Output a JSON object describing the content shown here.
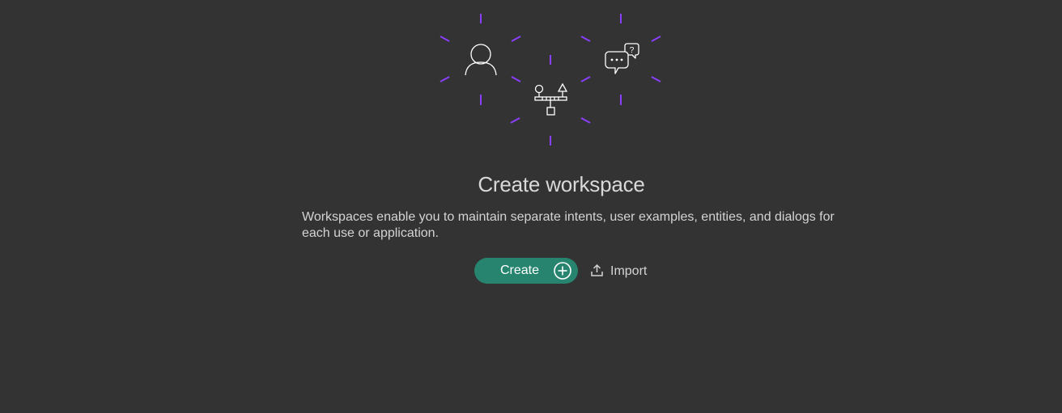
{
  "page": {
    "title": "Create workspace",
    "description": "Workspaces enable you to maintain separate intents, user examples, entities, and dialogs for each use or application."
  },
  "actions": {
    "create_label": "Create",
    "import_label": "Import"
  },
  "illustration": {
    "icons": [
      "user-icon",
      "logic-flow-icon",
      "chat-question-icon"
    ],
    "question_mark": "?",
    "accent_color": "#8a3ffc"
  },
  "colors": {
    "background": "#333333",
    "primary_button": "#27856f",
    "text": "#d4d4d4"
  }
}
